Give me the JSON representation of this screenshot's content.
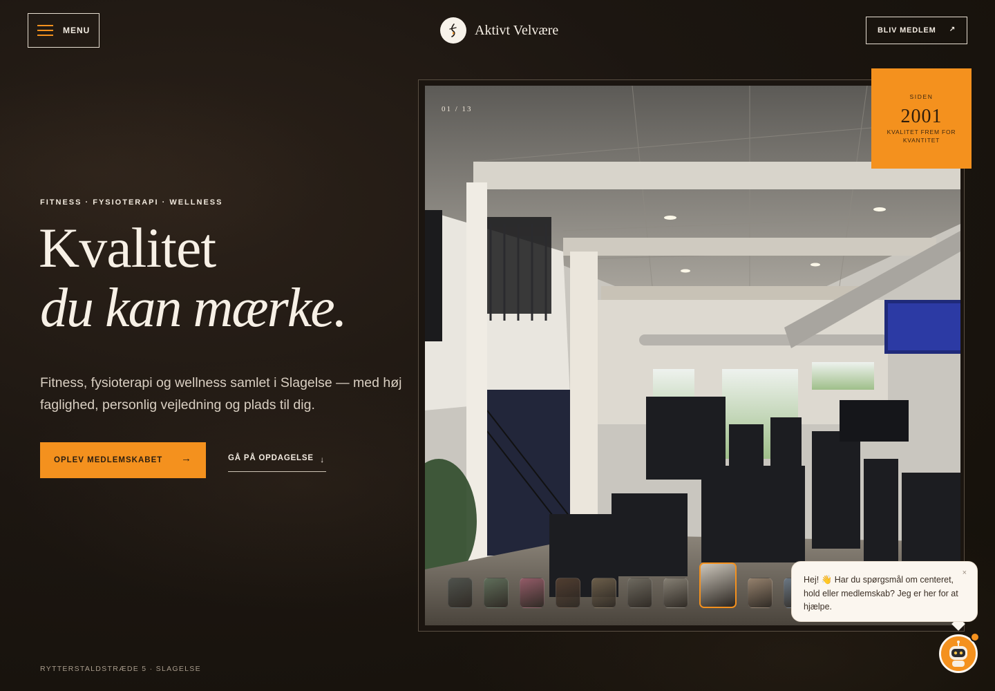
{
  "header": {
    "menu_label": "MENU",
    "logo_text": "Aktivt Velvære",
    "join_label": "BLIV MEDLEM",
    "join_icon": "arrow-up-right-icon"
  },
  "hero": {
    "eyebrow": "FITNESS · FYSIOTERAPI · WELLNESS",
    "title_line1": "Kvalitet",
    "title_line2": "du kan mærke.",
    "lead": "Fitness, fysioterapi og wellness samlet i Slagelse — med høj faglighed, personlig vejledning og plads til dig.",
    "cta_primary": "OPLEV MEDLEMSKABET",
    "cta_primary_icon": "arrow-right-icon",
    "cta_secondary": "GÅ PÅ OPDAGELSE",
    "cta_secondary_icon": "arrow-down-icon",
    "address": "RYTTERSTALDSTRÆDE 5 · SLAGELSE"
  },
  "gallery": {
    "counter": "01 / 13",
    "current_slide": 1,
    "total_slides": 13,
    "thumbnails": [
      {
        "label": "thumb-1"
      },
      {
        "label": "thumb-2"
      },
      {
        "label": "thumb-3"
      },
      {
        "label": "thumb-4"
      },
      {
        "label": "thumb-5"
      },
      {
        "label": "thumb-6"
      },
      {
        "label": "thumb-7"
      },
      {
        "label": "thumb-8"
      },
      {
        "label": "thumb-9"
      },
      {
        "label": "thumb-10"
      }
    ],
    "active_thumbnail": 8
  },
  "badge": {
    "since": "SIDEN",
    "year": "2001",
    "motto": "KVALITET FREM FOR KVANTITET"
  },
  "chat": {
    "message": "Hej! 👋 Har du spørgsmål om centeret, hold eller medlemskab? Jeg er her for at hjælpe.",
    "close": "×"
  },
  "colors": {
    "accent": "#f4911e",
    "background": "#1c1611",
    "text": "#f7f0e6"
  }
}
